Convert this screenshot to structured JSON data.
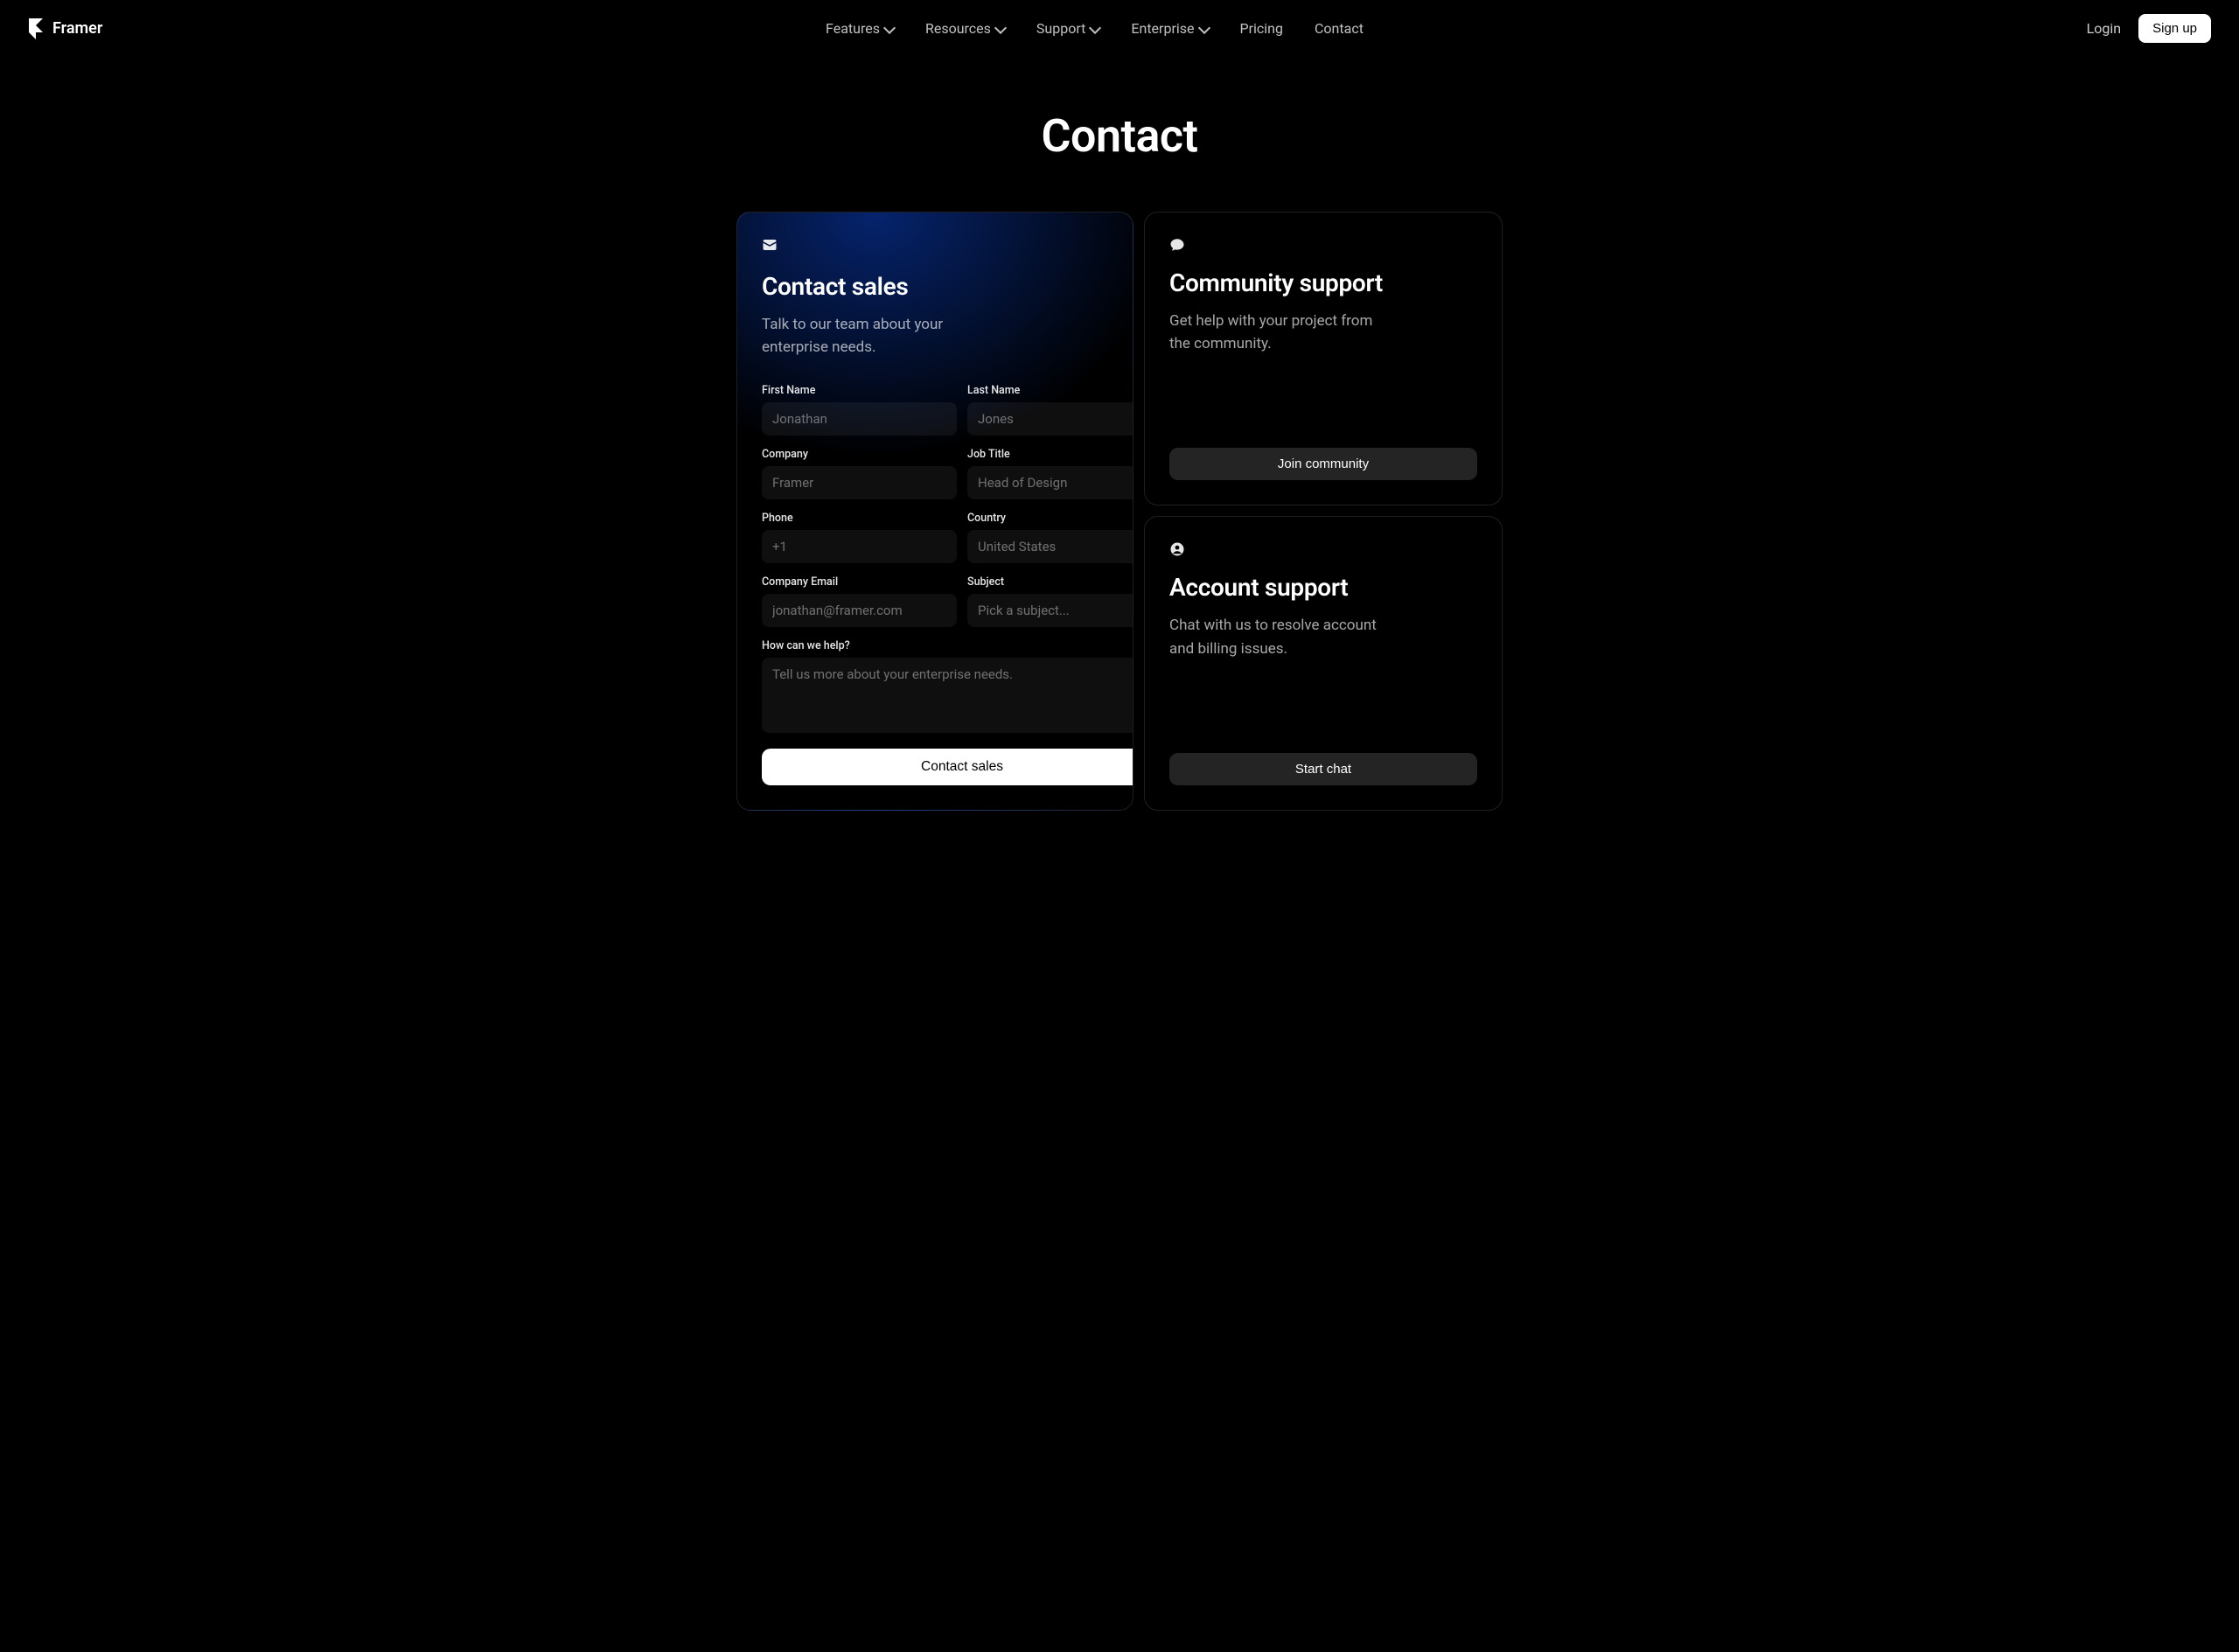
{
  "brand": "Framer",
  "nav": {
    "items": [
      {
        "label": "Features",
        "dropdown": true
      },
      {
        "label": "Resources",
        "dropdown": true
      },
      {
        "label": "Support",
        "dropdown": true
      },
      {
        "label": "Enterprise",
        "dropdown": true
      },
      {
        "label": "Pricing",
        "dropdown": false
      },
      {
        "label": "Contact",
        "dropdown": false
      }
    ],
    "login": "Login",
    "signup": "Sign up"
  },
  "page_title": "Contact",
  "sales": {
    "title": "Contact sales",
    "desc": "Talk to our team about your enterprise needs.",
    "fields": {
      "first_name": {
        "label": "First Name",
        "placeholder": "Jonathan"
      },
      "last_name": {
        "label": "Last Name",
        "placeholder": "Jones"
      },
      "company": {
        "label": "Company",
        "placeholder": "Framer"
      },
      "job_title": {
        "label": "Job Title",
        "placeholder": "Head of Design"
      },
      "phone": {
        "label": "Phone",
        "placeholder": "+1"
      },
      "country": {
        "label": "Country",
        "placeholder": "United States"
      },
      "email": {
        "label": "Company Email",
        "placeholder": "jonathan@framer.com"
      },
      "subject": {
        "label": "Subject",
        "placeholder": "Pick a subject..."
      },
      "help": {
        "label": "How can we help?",
        "placeholder": "Tell us more about your enterprise needs."
      }
    },
    "submit": "Contact sales"
  },
  "community": {
    "title": "Community support",
    "desc": "Get help with your project from the community.",
    "cta": "Join community"
  },
  "account": {
    "title": "Account support",
    "desc": "Chat with us to resolve account and billing issues.",
    "cta": "Start chat"
  }
}
